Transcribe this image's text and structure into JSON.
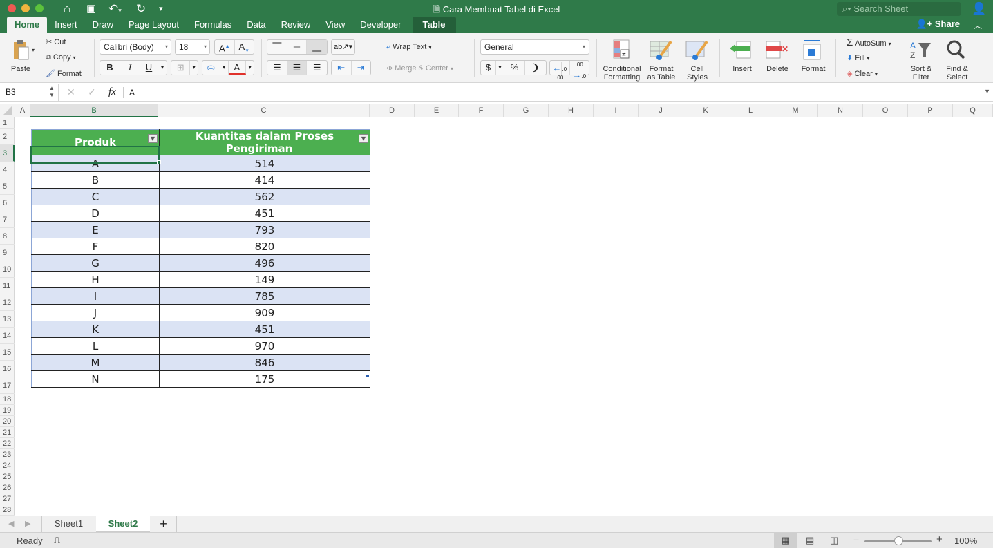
{
  "window": {
    "title": "Cara Membuat Tabel di Excel",
    "search_placeholder": "Search Sheet",
    "share_label": "Share"
  },
  "tabs": [
    {
      "label": "Home",
      "active": true
    },
    {
      "label": "Insert"
    },
    {
      "label": "Draw"
    },
    {
      "label": "Page Layout"
    },
    {
      "label": "Formulas"
    },
    {
      "label": "Data"
    },
    {
      "label": "Review"
    },
    {
      "label": "View"
    },
    {
      "label": "Developer"
    },
    {
      "label": "Table",
      "contextual": true
    }
  ],
  "ribbon": {
    "paste": "Paste",
    "cut": "Cut",
    "copy": "Copy",
    "format_painter": "Format",
    "font_name": "Calibri (Body)",
    "font_size": "18",
    "bold": "B",
    "italic": "I",
    "underline": "U",
    "wrap_text": "Wrap Text",
    "merge_center": "Merge & Center",
    "number_format": "General",
    "currency": "$",
    "percent": "%",
    "comma": "❩",
    "conditional_formatting": [
      "Conditional",
      "Formatting"
    ],
    "format_as_table": [
      "Format",
      "as Table"
    ],
    "cell_styles": [
      "Cell",
      "Styles"
    ],
    "insert": "Insert",
    "delete": "Delete",
    "format": "Format",
    "autosum": "AutoSum",
    "fill": "Fill",
    "clear": "Clear",
    "sort_filter": [
      "Sort &",
      "Filter"
    ],
    "find_select": [
      "Find &",
      "Select"
    ]
  },
  "formula_bar": {
    "name_box": "B3",
    "fx": "fx",
    "value": "A"
  },
  "columns": [
    "A",
    "B",
    "C",
    "D",
    "E",
    "F",
    "G",
    "H",
    "I",
    "J",
    "K",
    "L",
    "M",
    "N",
    "O",
    "P",
    "Q"
  ],
  "rows": [
    "1",
    "2",
    "3",
    "4",
    "5",
    "6",
    "7",
    "8",
    "9",
    "10",
    "11",
    "12",
    "13",
    "14",
    "15",
    "16",
    "17",
    "18",
    "19",
    "20",
    "21",
    "22",
    "23",
    "24",
    "25",
    "26",
    "27",
    "28"
  ],
  "table": {
    "headers": [
      "Produk",
      "Kuantitas dalam Proses Pengiriman"
    ],
    "rows": [
      [
        "A",
        "514"
      ],
      [
        "B",
        "414"
      ],
      [
        "C",
        "562"
      ],
      [
        "D",
        "451"
      ],
      [
        "E",
        "793"
      ],
      [
        "F",
        "820"
      ],
      [
        "G",
        "496"
      ],
      [
        "H",
        "149"
      ],
      [
        "I",
        "785"
      ],
      [
        "J",
        "909"
      ],
      [
        "K",
        "451"
      ],
      [
        "L",
        "970"
      ],
      [
        "M",
        "846"
      ],
      [
        "N",
        "175"
      ]
    ]
  },
  "sheets": [
    {
      "label": "Sheet1"
    },
    {
      "label": "Sheet2",
      "active": true
    }
  ],
  "status": {
    "text": "Ready",
    "zoom": "100%",
    "zoom_level_percent": 100
  },
  "colors": {
    "accent": "#2f7a49",
    "table_header": "#4caf50",
    "band": "#dbe3f4"
  }
}
